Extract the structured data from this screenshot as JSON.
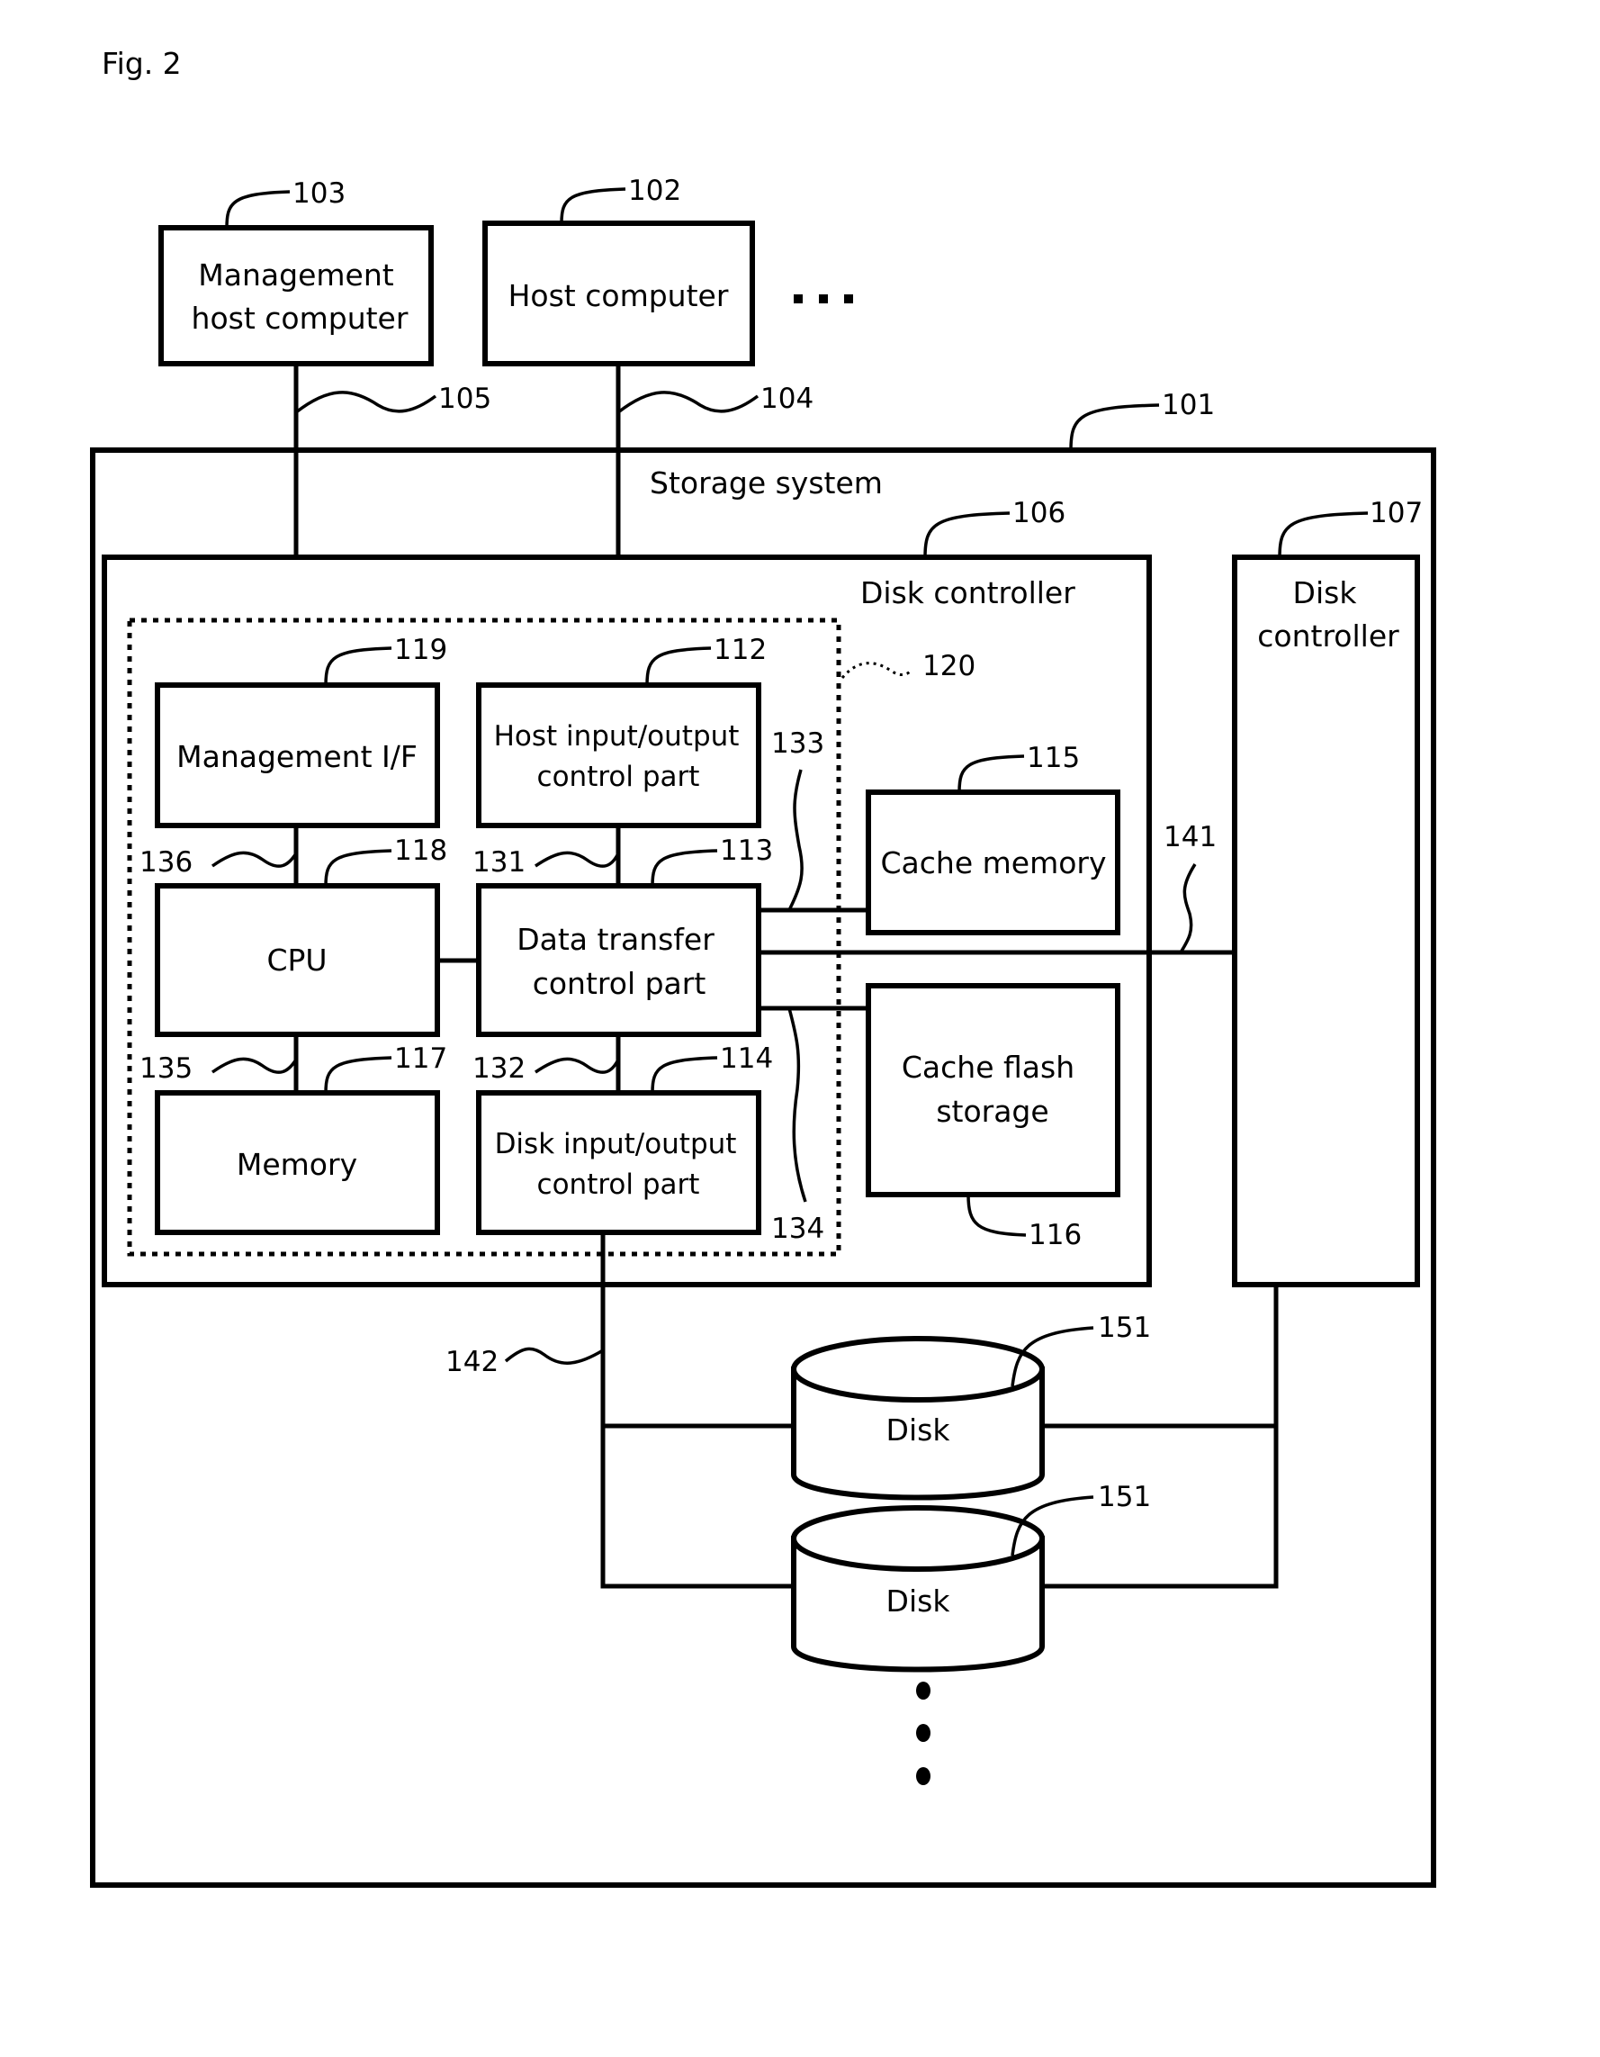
{
  "figure_label": "Fig. 2",
  "external": {
    "management_host": {
      "line1": "Management",
      "line2": "host computer",
      "ref": "103"
    },
    "host": {
      "label": "Host computer",
      "ref": "102"
    },
    "more_hosts": "…",
    "mgmt_link_ref": "105",
    "host_link_ref": "104"
  },
  "storage_system": {
    "label": "Storage system",
    "ref": "101",
    "disk_controller_main": {
      "label": "Disk controller",
      "ref": "106",
      "group_ref": "120",
      "components": {
        "management_if": {
          "label": "Management I/F",
          "ref": "119"
        },
        "host_io": {
          "line1": "Host input/output",
          "line2": "control part",
          "ref": "112"
        },
        "cpu": {
          "label": "CPU",
          "ref": "118"
        },
        "data_transfer": {
          "line1": "Data transfer",
          "line2": "control part",
          "ref": "113"
        },
        "memory": {
          "label": "Memory",
          "ref": "117"
        },
        "disk_io": {
          "line1": "Disk input/output",
          "line2": "control part",
          "ref": "114"
        },
        "cache_memory": {
          "label": "Cache memory",
          "ref": "115"
        },
        "cache_flash": {
          "line1": "Cache flash",
          "line2": "storage",
          "ref": "116"
        }
      },
      "link_refs": {
        "mgmt_cpu": "136",
        "cpu_memory": "135",
        "hostio_dt": "131",
        "dt_diskio": "132",
        "dt_cache_memory": "133",
        "dt_cache_flash": "134"
      }
    },
    "disk_controller_other": {
      "line1": "Disk",
      "line2": "controller",
      "ref": "107"
    },
    "inter_controller_ref": "141",
    "disk_bus_ref": "142",
    "disks": [
      {
        "label": "Disk",
        "ref": "151"
      },
      {
        "label": "Disk",
        "ref": "151"
      }
    ]
  }
}
